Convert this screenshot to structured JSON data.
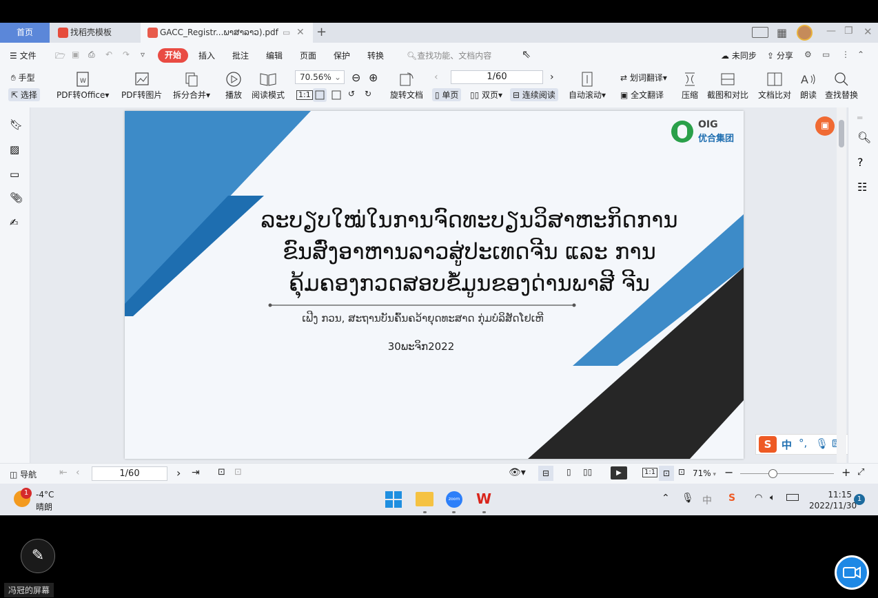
{
  "tabs": {
    "home": "首页",
    "template": "找稻壳模板",
    "pdf": "GACC_Registr...ພາສາລາວ).pdf"
  },
  "menu": {
    "file": "文件",
    "start": "开始",
    "insert": "插入",
    "annotate": "批注",
    "edit": "编辑",
    "page": "页面",
    "protect": "保护",
    "convert": "转换",
    "search_placeholder": "查找功能、文档内容",
    "unsync": "未同步",
    "share": "分享"
  },
  "ribbon": {
    "hand": "手型",
    "select": "选择",
    "pdf_to_office": "PDF转Office",
    "pdf_to_image": "PDF转图片",
    "split_merge": "拆分合并",
    "play": "播放",
    "read_mode": "阅读模式",
    "zoom": "70.56%",
    "page_input": "1/60",
    "rotate": "旋转文档",
    "single_page": "单页",
    "double_page": "双页",
    "continuous": "连续阅读",
    "auto_scroll": "自动滚动",
    "word_translate": "划词翻译",
    "full_translate": "全文翻译",
    "compress": "压缩",
    "screenshot_compare": "截图和对比",
    "doc_compare": "文档比对",
    "read_aloud": "朗读",
    "find_replace": "查找替换"
  },
  "slide": {
    "logo_text": "OIG",
    "logo_sub": "优合集团",
    "title_line1": "ລະບຽບໃໝ່ໃນການຈົດທະບຽນວິສາຫະກິດການ",
    "title_line2": "ຂົນສົ່ງອາຫານລາວສູ່ປະເທດຈີນ ແລະ ການ",
    "title_line3": "ຄຸ້ມຄອງກວດສອບຂໍ້ມູນຂອງດ່ານພາສີ ຈີນ",
    "subtitle": "ເຟີງ ກວນ, ສະຖານບັນຄົ້ນຄວ້າຍຸດທະສາດ ກຸ່ມບໍລິສັດໂຢເຫີ",
    "date": "30ພະຈິກ2022"
  },
  "statusbar": {
    "nav": "导航",
    "page_input": "1/60",
    "zoom": "71%"
  },
  "ime": {
    "mode": "中",
    "punct": "°,"
  },
  "taskbar": {
    "weather_badge": "1",
    "temperature": "-4°C",
    "weather": "晴朗",
    "ime_char": "中",
    "time": "11:15",
    "date": "2022/11/30",
    "notif_count": "1"
  },
  "overlay": {
    "screen_owner": "冯冠的屏幕"
  },
  "colors": {
    "accent_blue": "#5b87d9",
    "start_red": "#e94b43",
    "slide_blue_light": "#3d8bc8",
    "slide_blue_dark": "#1e6eb0",
    "slide_black": "#262626"
  }
}
